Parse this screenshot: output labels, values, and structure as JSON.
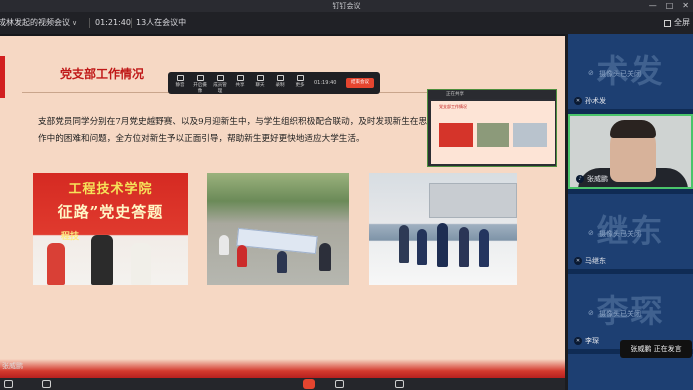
{
  "window": {
    "title": "钉钉会议"
  },
  "infobar": {
    "meeting_name": "成林发起的视频会议",
    "timer": "01:21:40",
    "participants": "13人在会议中",
    "fullscreen_label": "全屏"
  },
  "shared_toolbar": {
    "items": [
      "静音",
      "开启摄像",
      "成员管理",
      "共享",
      "聊天",
      "录制",
      "更多"
    ],
    "timer": "01:19:40",
    "end_label": "结束会议"
  },
  "slide": {
    "heading": "党支部工作情况",
    "body": "支部党员同学分别在7月党史越野赛、以及9月迎新生中，与学生组织积极配合联动，及时发现新生在思想、学习、生活、工作中的困难和问题，全方位对新生予以正面引导，帮助新生更好更快地适应大学生活。",
    "photo1_lines": [
      "工程技术学院",
      "征路”党史答题",
      "程技"
    ]
  },
  "preview": {
    "title": "正在共享"
  },
  "participants": [
    {
      "big": "术发",
      "status": "摄像头已关闭",
      "name": "孙术发"
    },
    {
      "name": "张威鹏",
      "status": ""
    },
    {
      "big": "继东",
      "status": "摄像头已关闭",
      "name": "马继东"
    },
    {
      "big": "李琛",
      "status": "摄像头已关闭",
      "name": "李琛"
    }
  ],
  "speaking_label": "张威鹏  正在发言",
  "name_badge": "张威鹏"
}
